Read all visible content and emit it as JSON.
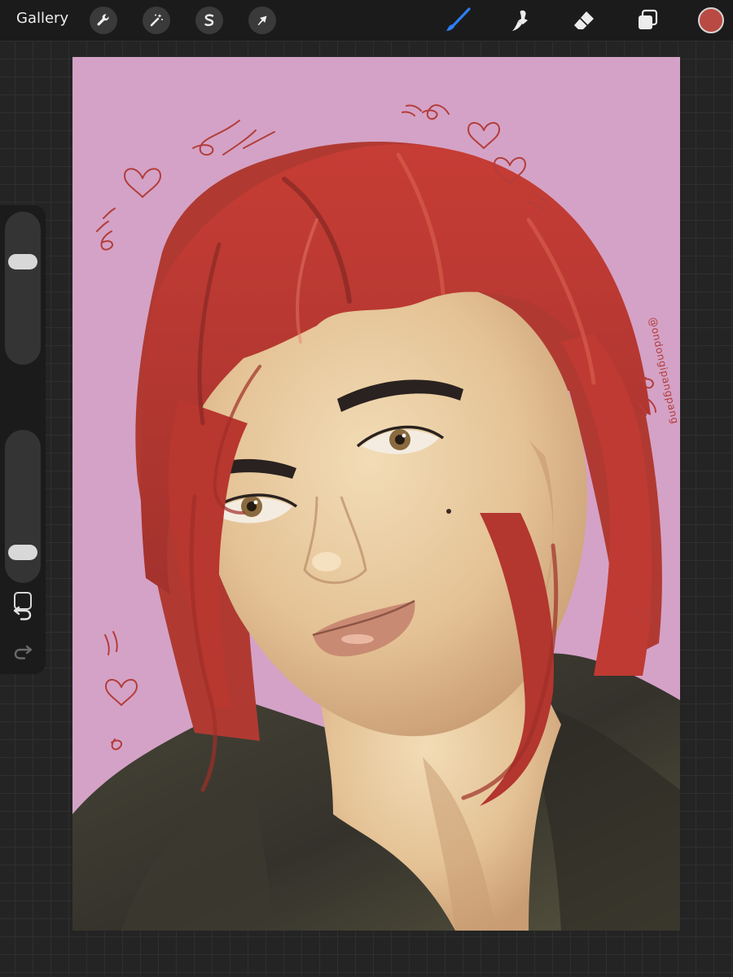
{
  "topbar": {
    "gallery_label": "Gallery",
    "left_tools": [
      {
        "name": "actions",
        "icon": "wrench-icon"
      },
      {
        "name": "adjustments",
        "icon": "magic-wand-icon"
      },
      {
        "name": "selection",
        "icon": "selection-icon"
      },
      {
        "name": "transform",
        "icon": "transform-arrow-icon"
      }
    ],
    "right_tools": [
      {
        "name": "brush",
        "icon": "brush-icon",
        "active": true
      },
      {
        "name": "smudge",
        "icon": "smudge-icon"
      },
      {
        "name": "eraser",
        "icon": "eraser-icon"
      },
      {
        "name": "layers",
        "icon": "layers-icon"
      }
    ],
    "current_color": "#b94a43",
    "active_tool_color": "#2e7df6"
  },
  "sidebar": {
    "brush_size_level": 0.7,
    "opacity_level": 0.15,
    "undo_icon": "undo-icon",
    "redo_icon": "redo-icon",
    "modify_icon": "square-icon"
  },
  "canvas": {
    "background_color": "#d4a2c6",
    "signature": "@ondongipangpang"
  }
}
